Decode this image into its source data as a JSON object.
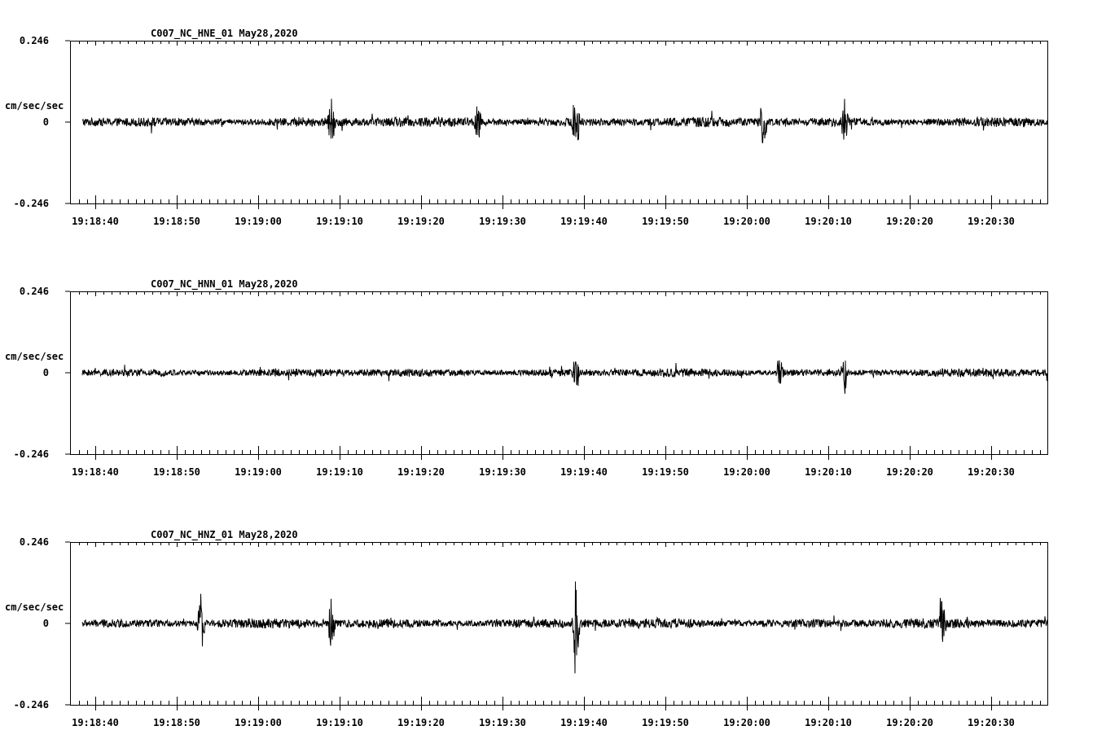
{
  "chart_data": [
    {
      "type": "line",
      "title": "C007_NC_HNE_01   May28,2020",
      "ylabel": "cm/sec/sec",
      "ylim": [
        -0.246,
        0.246
      ],
      "y_ticks": [
        "0.246",
        "0",
        "-0.246"
      ],
      "x_tick_labels": [
        "19:18:40",
        "19:18:50",
        "19:19:00",
        "19:19:10",
        "19:19:20",
        "19:19:30",
        "19:19:40",
        "19:19:50",
        "19:20:00",
        "19:20:10",
        "19:20:20",
        "19:20:30"
      ],
      "series": [
        {
          "color": "#000000",
          "base_amplitude": 0.012,
          "events": [
            {
              "t": "19:19:09",
              "amp": 0.1
            },
            {
              "t": "19:19:27",
              "amp": 0.09
            },
            {
              "t": "19:19:39",
              "amp": 0.16
            },
            {
              "t": "19:20:02",
              "amp": 0.12
            },
            {
              "t": "19:20:12",
              "amp": 0.09
            }
          ]
        }
      ]
    },
    {
      "type": "line",
      "title": "C007_NC_HNN_01   May28,2020",
      "ylabel": "cm/sec/sec",
      "ylim": [
        -0.246,
        0.246
      ],
      "y_ticks": [
        "0.246",
        "0",
        "-0.246"
      ],
      "x_tick_labels": [
        "19:18:40",
        "19:18:50",
        "19:19:00",
        "19:19:10",
        "19:19:20",
        "19:19:30",
        "19:19:40",
        "19:19:50",
        "19:20:00",
        "19:20:10",
        "19:20:20",
        "19:20:30"
      ],
      "series": [
        {
          "color": "#000000",
          "base_amplitude": 0.01,
          "events": [
            {
              "t": "19:19:39",
              "amp": 0.08
            },
            {
              "t": "19:20:04",
              "amp": 0.07
            },
            {
              "t": "19:20:12",
              "amp": 0.08
            }
          ]
        }
      ]
    },
    {
      "type": "line",
      "title": "C007_NC_HNZ_01   May28,2020",
      "ylabel": "cm/sec/sec",
      "ylim": [
        -0.246,
        0.246
      ],
      "y_ticks": [
        "0.246",
        "0",
        "-0.246"
      ],
      "x_tick_labels": [
        "19:18:40",
        "19:18:50",
        "19:19:00",
        "19:19:10",
        "19:19:20",
        "19:19:30",
        "19:19:40",
        "19:19:50",
        "19:20:00",
        "19:20:10",
        "19:20:20",
        "19:20:30"
      ],
      "series": [
        {
          "color": "#000000",
          "base_amplitude": 0.012,
          "events": [
            {
              "t": "19:18:53",
              "amp": 0.13
            },
            {
              "t": "19:19:09",
              "amp": 0.1
            },
            {
              "t": "19:19:39",
              "amp": 0.22
            },
            {
              "t": "19:20:24",
              "amp": 0.14
            }
          ]
        }
      ]
    }
  ]
}
